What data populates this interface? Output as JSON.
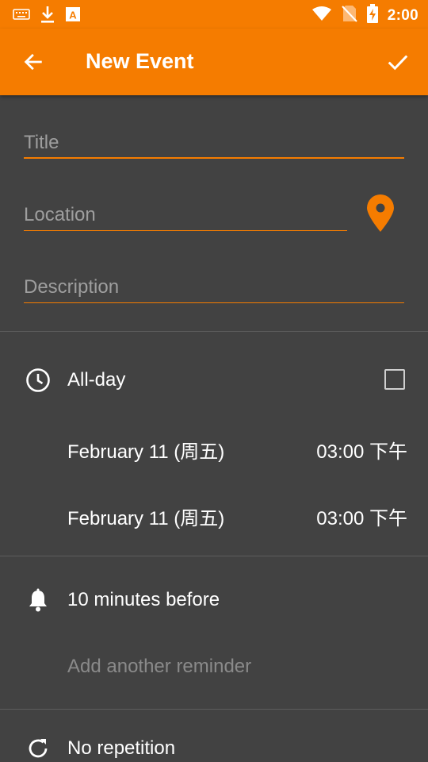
{
  "status_bar": {
    "time": "2:00",
    "icons_left": [
      "keyboard-icon",
      "download-icon",
      "font-app-icon"
    ],
    "icons_right": [
      "wifi-icon",
      "no-sim-icon",
      "battery-charging-icon"
    ]
  },
  "toolbar": {
    "title": "New Event",
    "back_icon": "arrow-left-icon",
    "save_icon": "check-icon"
  },
  "form": {
    "title_placeholder": "Title",
    "location_placeholder": "Location",
    "description_placeholder": "Description"
  },
  "time_section": {
    "all_day_label": "All-day",
    "all_day_checked": false,
    "start_date": "February 11 (周五)",
    "start_time": "03:00 下午",
    "end_date": "February 11 (周五)",
    "end_time": "03:00 下午"
  },
  "reminders": {
    "reminder_1": "10 minutes before",
    "add_reminder": "Add another reminder"
  },
  "repetition": {
    "label": "No repetition"
  },
  "colors": {
    "accent": "#f57c00",
    "background": "#424242",
    "hint_text": "#9e9e9e"
  }
}
